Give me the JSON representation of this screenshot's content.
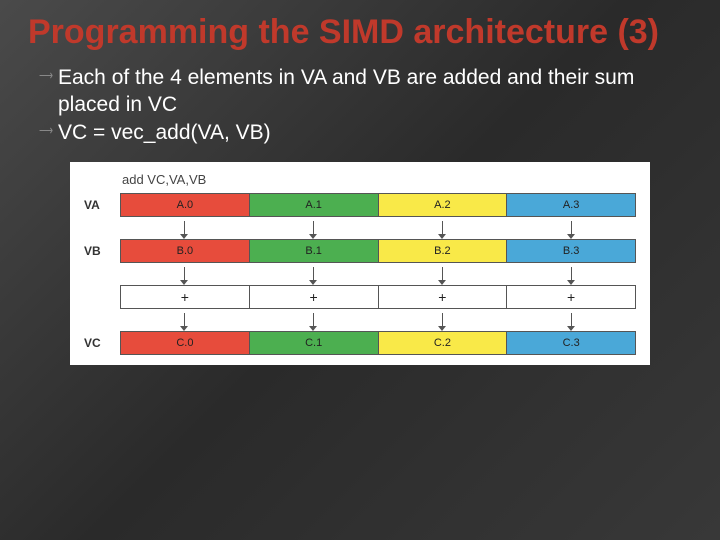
{
  "title": "Programming the SIMD architecture (3)",
  "bullets": [
    "Each of the 4 elements in VA and VB are added and their sum placed in VC",
    "VC = vec_add(VA, VB)"
  ],
  "instruction": "add VC,VA,VB",
  "rows": {
    "va": {
      "label": "VA",
      "cells": [
        "A.0",
        "A.1",
        "A.2",
        "A.3"
      ]
    },
    "vb": {
      "label": "VB",
      "cells": [
        "B.0",
        "B.1",
        "B.2",
        "B.3"
      ]
    },
    "op": {
      "label": "",
      "cells": [
        "+",
        "+",
        "+",
        "+"
      ]
    },
    "vc": {
      "label": "VC",
      "cells": [
        "C.0",
        "C.1",
        "C.2",
        "C.3"
      ]
    }
  },
  "colors": [
    "red",
    "green",
    "yellow",
    "blue"
  ]
}
